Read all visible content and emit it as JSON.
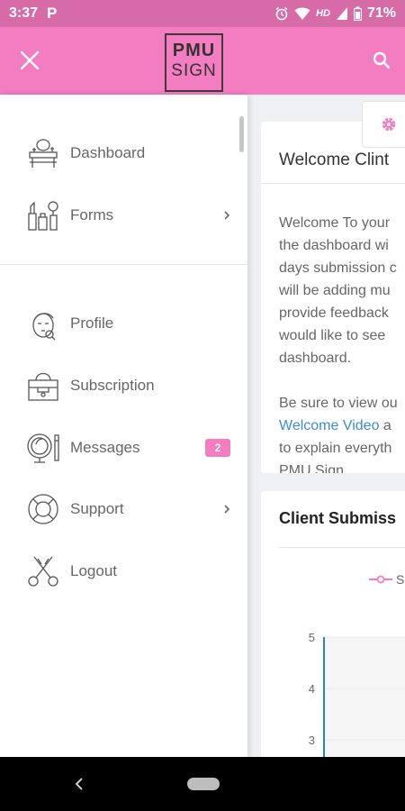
{
  "status_bar": {
    "time": "3:37",
    "app_icon": "P",
    "battery_text": "71%",
    "network": "HD",
    "icons": [
      "alarm-icon",
      "wifi-icon",
      "signal-icon",
      "battery-icon"
    ]
  },
  "header": {
    "logo_line1": "PMU",
    "logo_line2": "SIGN",
    "brand_color": "#f47cc0"
  },
  "drawer": {
    "items": [
      {
        "label": "Dashboard",
        "icon": "vanity-icon"
      },
      {
        "label": "Forms",
        "icon": "cosmetics-icon",
        "has_chevron": true
      },
      {
        "label": "Profile",
        "icon": "face-icon"
      },
      {
        "label": "Subscription",
        "icon": "handbag-icon"
      },
      {
        "label": "Messages",
        "icon": "mirror-icon",
        "badge": "2"
      },
      {
        "label": "Support",
        "icon": "lifebuoy-icon",
        "has_chevron": true
      },
      {
        "label": "Logout",
        "icon": "scissors-icon"
      }
    ],
    "help_icon": "?"
  },
  "main": {
    "welcome": {
      "title": "Welcome Clint",
      "lines": [
        "Welcome To your",
        "the dashboard wi",
        "days submission c",
        "will be adding mu",
        "provide feedback",
        "would like to see",
        "dashboard."
      ],
      "line2_1": "Be sure to view ou",
      "link": "Welcome Video",
      "link_suffix": " a",
      "line2_3": "to explain everyth",
      "line2_4": "PMU Sign."
    },
    "client_card": {
      "title": "Client Submiss",
      "legend": "S"
    }
  },
  "chart_data": {
    "type": "line",
    "title": "",
    "y_ticks": [
      5,
      4,
      3
    ],
    "ylim": [
      0,
      5
    ],
    "series": []
  }
}
